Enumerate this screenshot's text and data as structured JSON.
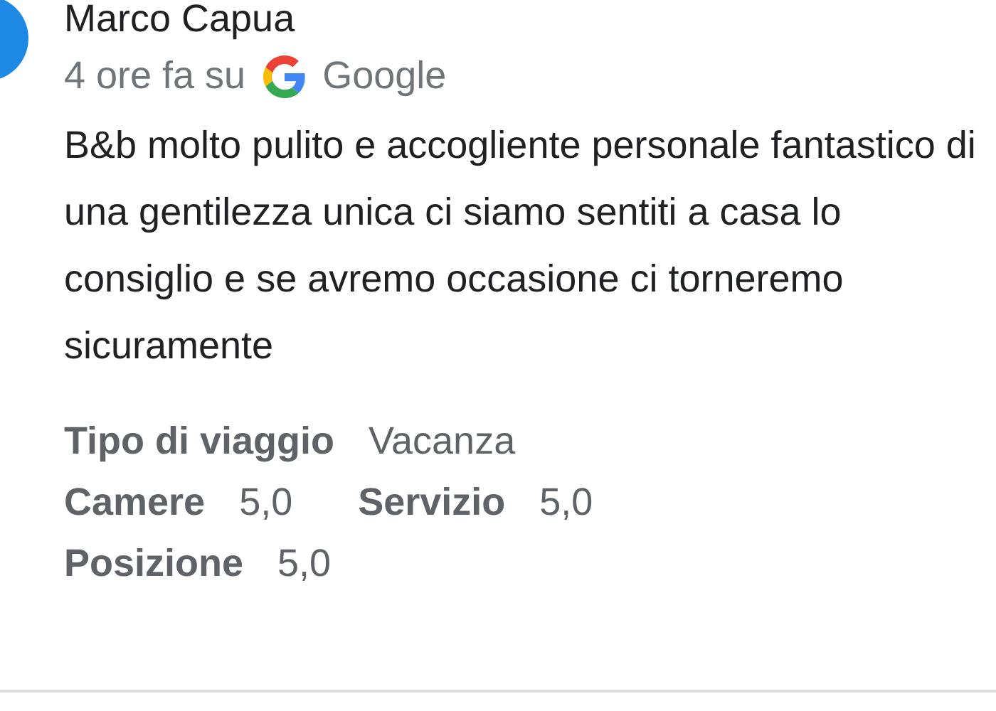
{
  "review": {
    "author": "Marco Capua",
    "time": "4 ore fa su",
    "source": "Google",
    "text": "B&b molto pulito e accogliente personale fantastico di una gentilezza unica ci siamo sentiti a casa lo consiglio e se avremo occasione ci torneremo sicuramente",
    "details": [
      [
        {
          "label": "Tipo di viaggio",
          "value": "Vacanza"
        }
      ],
      [
        {
          "label": "Camere",
          "value": "5,0"
        },
        {
          "label": "Servizio",
          "value": "5,0"
        }
      ],
      [
        {
          "label": "Posizione",
          "value": "5,0"
        }
      ]
    ]
  }
}
